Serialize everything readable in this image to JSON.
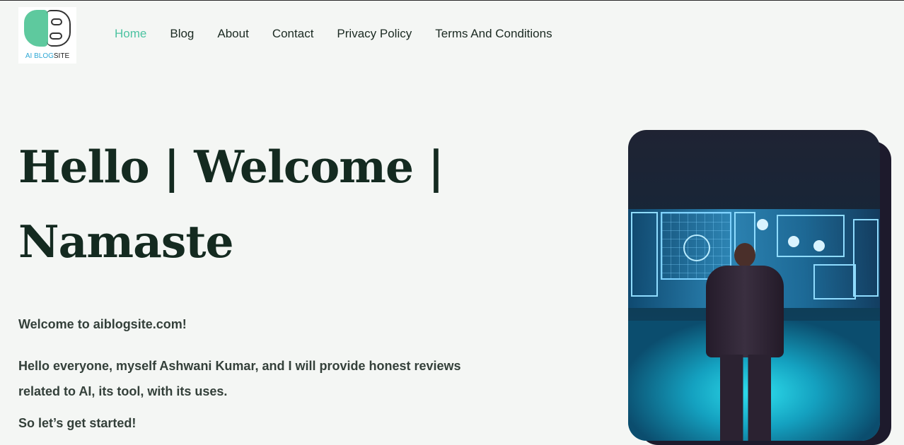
{
  "header": {
    "logo": {
      "text_part1": "AI BLOG",
      "text_part2": "SITE"
    },
    "nav": [
      {
        "label": "Home",
        "active": true
      },
      {
        "label": "Blog",
        "active": false
      },
      {
        "label": "About",
        "active": false
      },
      {
        "label": "Contact",
        "active": false
      },
      {
        "label": "Privacy Policy",
        "active": false
      },
      {
        "label": "Terms And Conditions",
        "active": false
      }
    ]
  },
  "hero": {
    "title_line1": "Hello | Welcome |",
    "title_line2": "Namaste",
    "paragraph1": "Welcome to aiblogsite.com!",
    "paragraph2": "Hello everyone, myself Ashwani Kumar, and I will provide honest reviews related to AI, its tool, with its uses.",
    "paragraph3": "So let’s get started!"
  },
  "colors": {
    "accent": "#4cc3a1",
    "background": "#f4f6f4",
    "heading": "#142a20"
  }
}
